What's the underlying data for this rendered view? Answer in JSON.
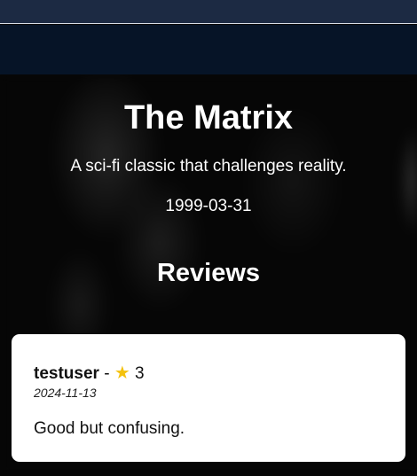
{
  "movie": {
    "title": "The Matrix",
    "description": "A sci-fi classic that challenges reality.",
    "release_date": "1999-03-31"
  },
  "reviews": {
    "heading": "Reviews",
    "items": [
      {
        "username": "testuser",
        "separator": "-",
        "star_icon": "★",
        "rating": "3",
        "date": "2024-11-13",
        "text": "Good but confusing."
      }
    ]
  },
  "colors": {
    "topbar": "#1c2a43",
    "navbar": "#061427",
    "star": "#f4c20d",
    "card": "#ffffff"
  }
}
